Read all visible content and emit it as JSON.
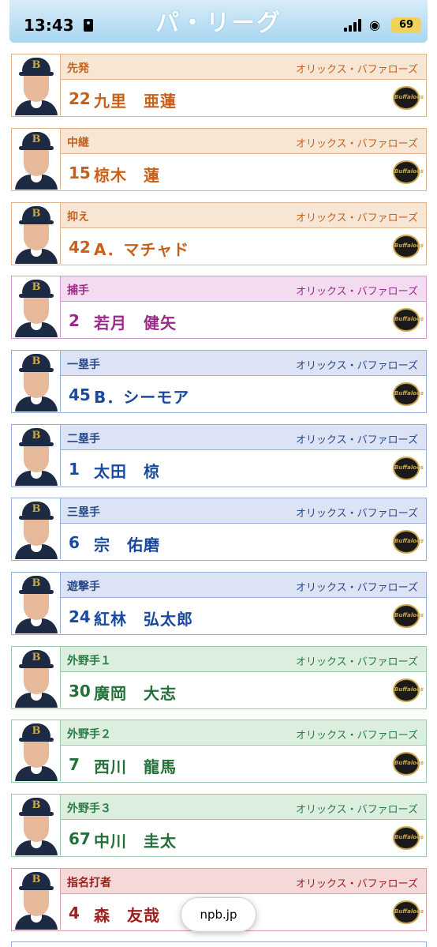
{
  "status_bar": {
    "time": "13:43",
    "battery": "69"
  },
  "header": {
    "title": "パ・リーグ"
  },
  "lineup": [
    {
      "position": "先発",
      "team": "オリックス・バファローズ",
      "number": "22",
      "name": "九里　亜蓮"
    },
    {
      "position": "中継",
      "team": "オリックス・バファローズ",
      "number": "15",
      "name": "椋木　蓮"
    },
    {
      "position": "抑え",
      "team": "オリックス・バファローズ",
      "number": "42",
      "name": "A．マチャド"
    },
    {
      "position": "捕手",
      "team": "オリックス・バファローズ",
      "number": "2",
      "name": "若月　健矢"
    },
    {
      "position": "一塁手",
      "team": "オリックス・バファローズ",
      "number": "45",
      "name": "B．シーモア"
    },
    {
      "position": "二塁手",
      "team": "オリックス・バファローズ",
      "number": "1",
      "name": "太田　椋"
    },
    {
      "position": "三塁手",
      "team": "オリックス・バファローズ",
      "number": "6",
      "name": "宗　佑磨"
    },
    {
      "position": "遊撃手",
      "team": "オリックス・バファローズ",
      "number": "24",
      "name": "紅林　弘太郎"
    },
    {
      "position": "外野手１",
      "team": "オリックス・バファローズ",
      "number": "30",
      "name": "廣岡　大志"
    },
    {
      "position": "外野手２",
      "team": "オリックス・バファローズ",
      "number": "7",
      "name": "西川　龍馬"
    },
    {
      "position": "外野手３",
      "team": "オリックス・バファローズ",
      "number": "67",
      "name": "中川　圭太"
    },
    {
      "position": "指名打者",
      "team": "オリックス・バファローズ",
      "number": "4",
      "name": "森　友哉"
    }
  ],
  "logo_text": "Buffaloes",
  "cap_letter": "B",
  "url_bar": {
    "domain": "npb.jp"
  },
  "colors": {
    "pitcher": "#c8601a",
    "catcher": "#9a2a88",
    "infield": "#1a4aa0",
    "outfield": "#23703a",
    "dh": "#a02020"
  }
}
